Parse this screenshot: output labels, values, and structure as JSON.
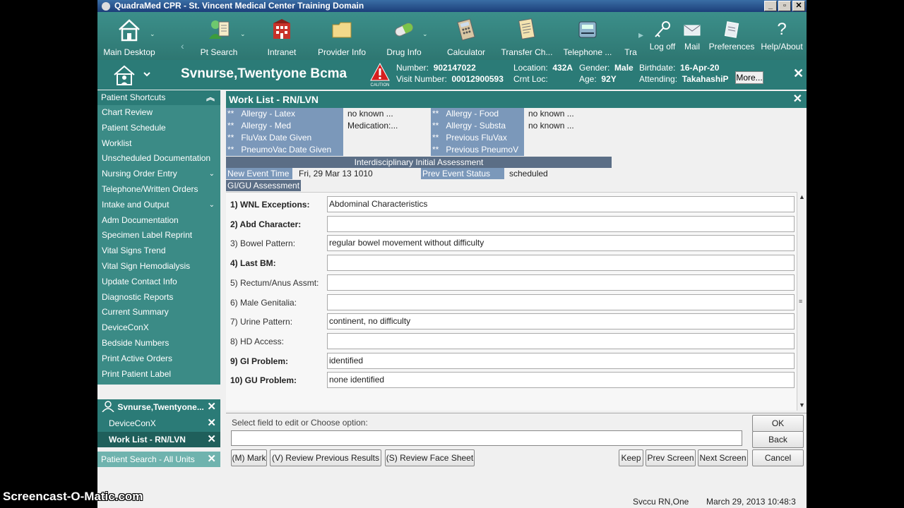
{
  "window": {
    "title": "QuadraMed CPR - St. Vincent Medical Center Training Domain",
    "min": "_",
    "max": "▫",
    "close": "✕"
  },
  "toolbar": {
    "items": [
      {
        "label": "Main Desktop",
        "icon": "house-icon"
      },
      {
        "label": "Pt Search",
        "icon": "patient-search-icon"
      },
      {
        "label": "Intranet",
        "icon": "intranet-icon"
      },
      {
        "label": "Provider Info",
        "icon": "folder-icon"
      },
      {
        "label": "Drug Info",
        "icon": "pill-icon"
      },
      {
        "label": "Calculator",
        "icon": "calculator-icon"
      },
      {
        "label": "Transfer Ch...",
        "icon": "transfer-chart-icon"
      },
      {
        "label": "Telephone ...",
        "icon": "telephone-icon"
      },
      {
        "label": "Tra",
        "icon": ""
      }
    ],
    "right": [
      {
        "label": "Log off",
        "icon": "key-icon"
      },
      {
        "label": "Mail",
        "icon": "mail-icon"
      },
      {
        "label": "Preferences",
        "icon": "preferences-icon"
      },
      {
        "label": "Help/About",
        "icon": "help-icon"
      }
    ]
  },
  "banner": {
    "name": "Svnurse,Twentyone Bcma",
    "number_label": "Number:",
    "number": "902147022",
    "visit_label": "Visit Number:",
    "visit": "00012900593",
    "location_label": "Location:",
    "location": "432A",
    "crnt_loc_label": "Crnt Loc:",
    "crnt_loc": "",
    "gender_label": "Gender:",
    "gender": "Male",
    "age_label": "Age:",
    "age": "92Y",
    "birthdate_label": "Birthdate:",
    "birthdate": "16-Apr-20",
    "attending_label": "Attending:",
    "attending": "TakahashiP",
    "more": "More...",
    "caution": "CAUTION",
    "close": "✕"
  },
  "sidebar": {
    "header": "Patient Shortcuts",
    "items": [
      {
        "label": "Chart Review",
        "expand": false
      },
      {
        "label": "Patient Schedule",
        "expand": false
      },
      {
        "label": "Worklist",
        "expand": false
      },
      {
        "label": "Unscheduled Documentation",
        "expand": false
      },
      {
        "label": "Nursing Order Entry",
        "expand": true
      },
      {
        "label": "Telephone/Written Orders",
        "expand": false
      },
      {
        "label": "Intake and Output",
        "expand": true
      },
      {
        "label": "Adm Documentation",
        "expand": false
      },
      {
        "label": "Specimen Label Reprint",
        "expand": false
      },
      {
        "label": "Vital Signs Trend",
        "expand": false
      },
      {
        "label": "Vital Sign Hemodialysis",
        "expand": false
      },
      {
        "label": "Update Contact Info",
        "expand": false
      },
      {
        "label": "Diagnostic Reports",
        "expand": false
      },
      {
        "label": "Current Summary",
        "expand": false
      },
      {
        "label": "DeviceConX",
        "expand": false
      },
      {
        "label": "Bedside Numbers",
        "expand": false
      },
      {
        "label": "Print Active Orders",
        "expand": false
      },
      {
        "label": "Print Patient Label",
        "expand": false
      }
    ],
    "open_patient": "Svnurse,Twentyone...",
    "open_tasks": [
      "DeviceConX",
      "Work List - RN/LVN"
    ],
    "patient_search": "Patient Search - All Units",
    "close": "✕"
  },
  "worklist": {
    "title": "Work List - RN/LVN",
    "close": "✕",
    "allergies_left": [
      {
        "label": "Allergy - Latex",
        "value": "no known ..."
      },
      {
        "label": "Allergy - Med",
        "value": "Medication:..."
      },
      {
        "label": "FluVax Date Given",
        "value": ""
      },
      {
        "label": "PneumoVac Date Given",
        "value": ""
      }
    ],
    "allergies_right": [
      {
        "label": "Allergy - Food",
        "value": "no known ..."
      },
      {
        "label": "Allergy - Substa",
        "value": "no known ..."
      },
      {
        "label": "Previous FluVax",
        "value": ""
      },
      {
        "label": "Previous PneumoV",
        "value": ""
      }
    ],
    "marker": "**",
    "section": "Interdisciplinary Initial Assessment",
    "new_event_label": "New Event Time",
    "new_event_value": "Fri, 29 Mar 13  1010",
    "prev_status_label": "Prev Event Status",
    "prev_status_value": "scheduled",
    "sub_section": "GI/GU Assessment"
  },
  "form": {
    "rows": [
      {
        "label": "1)  WNL Exceptions:",
        "bold": true,
        "value": "Abdominal Characteristics"
      },
      {
        "label": "2)  Abd Character:",
        "bold": true,
        "value": ""
      },
      {
        "label": "3)  Bowel Pattern:",
        "bold": false,
        "value": "regular bowel movement without difficulty"
      },
      {
        "label": "4)  Last BM:",
        "bold": true,
        "value": ""
      },
      {
        "label": "5)  Rectum/Anus Assmt:",
        "bold": false,
        "value": ""
      },
      {
        "label": "6)  Male Genitalia:",
        "bold": false,
        "value": ""
      },
      {
        "label": "7)  Urine Pattern:",
        "bold": false,
        "value": "continent, no difficulty"
      },
      {
        "label": "8)  HD Access:",
        "bold": false,
        "value": ""
      },
      {
        "label": "9)  GI Problem:",
        "bold": true,
        "value": "identified"
      },
      {
        "label": "10)  GU Problem:",
        "bold": true,
        "value": "none identified"
      }
    ]
  },
  "bottom": {
    "prompt": "Select field to edit or Choose option:",
    "ok": "OK",
    "back": "Back",
    "mark": "(M) Mark",
    "review_prev": "(V) Review Previous Results",
    "review_face": "(S) Review Face Sheet",
    "keep": "Keep",
    "prev_screen": "Prev Screen",
    "next_screen": "Next Screen",
    "cancel": "Cancel"
  },
  "status": {
    "user": "Svccu RN,One",
    "datetime": "March 29, 2013 10:48:3"
  },
  "watermark": "Screencast-O-Matic.com"
}
